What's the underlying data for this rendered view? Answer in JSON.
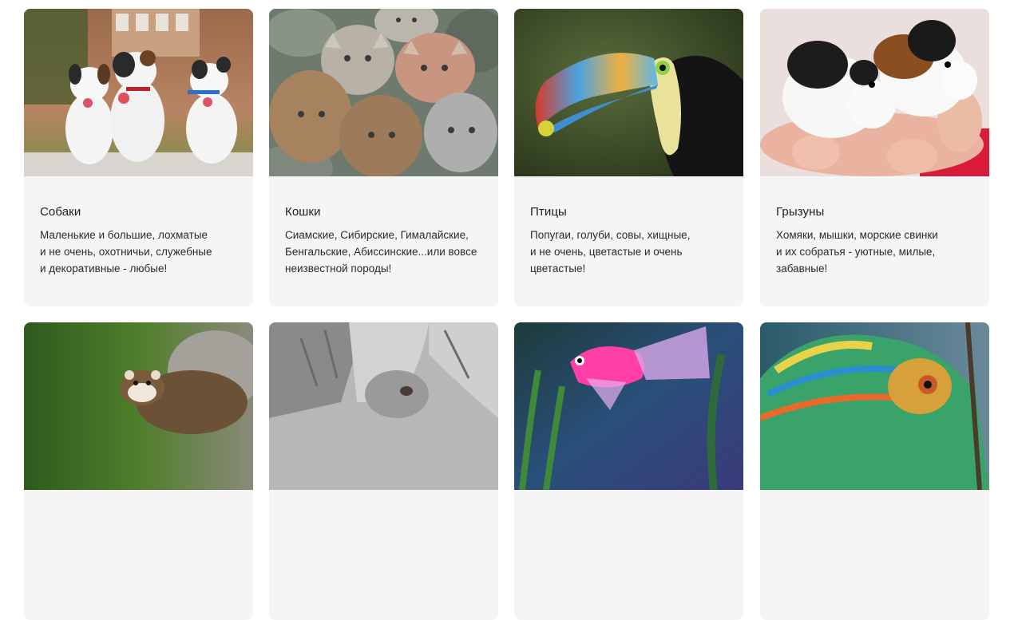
{
  "categories": [
    {
      "title": "Собаки",
      "desc": [
        "Маленькие и большие, лохматые",
        "и не очень, охотничьи, служебные",
        "и декоративные - любые!"
      ],
      "image": "puppies-photo"
    },
    {
      "title": "Кошки",
      "desc": [
        "Сиамские, Сибирские, Гималайские,",
        "Бенгальские, Абиссинские...или вовсе",
        "неизвестной породы!"
      ],
      "image": "painted-cat-stones-photo"
    },
    {
      "title": "Птицы",
      "desc": [
        "Попугаи, голуби, совы, хищные,",
        "и не очень, цветастые и очень",
        "цветастые!"
      ],
      "image": "toucan-photo"
    },
    {
      "title": "Грызуны",
      "desc": [
        "Хомяки, мышки, морские свинки",
        "и их собратья - уютные, милые,",
        "забавные!"
      ],
      "image": "guinea-pigs-photo"
    },
    {
      "image": "ferret-photo"
    },
    {
      "image": "horse-photo"
    },
    {
      "image": "aquarium-fish-photo"
    },
    {
      "image": "chameleon-photo"
    }
  ]
}
